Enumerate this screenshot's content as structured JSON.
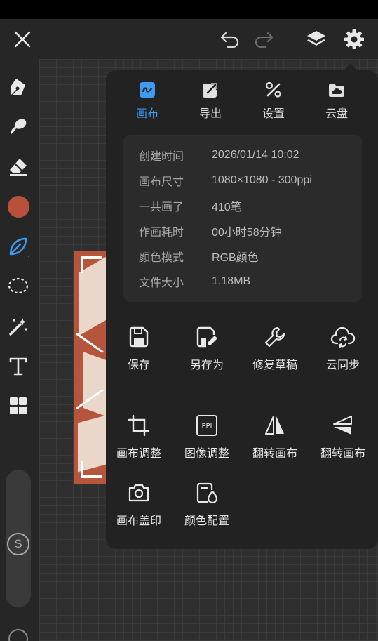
{
  "tabs": [
    {
      "label": "画布",
      "active": true
    },
    {
      "label": "导出",
      "active": false
    },
    {
      "label": "设置",
      "active": false
    },
    {
      "label": "云盘",
      "active": false
    }
  ],
  "info": [
    {
      "key": "创建时间",
      "value": "2026/01/14 10:02"
    },
    {
      "key": "画布尺寸",
      "value": "1080×1080 - 300ppi"
    },
    {
      "key": "一共画了",
      "value": "410笔"
    },
    {
      "key": "作画耗时",
      "value": "00小时58分钟"
    },
    {
      "key": "颜色模式",
      "value": "RGB颜色"
    },
    {
      "key": "文件大小",
      "value": "1.18MB"
    }
  ],
  "actions_row1": [
    "保存",
    "另存为",
    "修复草稿",
    "云同步"
  ],
  "actions_row2": [
    "画布调整",
    "图像调整",
    "翻转画布",
    "翻转画布"
  ],
  "actions_row3": [
    "画布盖印",
    "颜色配置"
  ],
  "ppi_icon_text": "PPI",
  "brush_size_label": "S",
  "colors": {
    "accent": "#3d9bf2",
    "current_color": "#b8513a",
    "panel_bg": "#222222"
  },
  "icons": {
    "topbar": [
      "close-icon",
      "undo-icon",
      "redo-icon",
      "layers-icon",
      "settings-gear-icon"
    ],
    "tools": [
      "pen-icon",
      "smudge-icon",
      "eraser-icon",
      "color-picker",
      "leaf-brush-icon",
      "lasso-select-icon",
      "magic-wand-icon",
      "text-tool-icon",
      "grid-tools-icon"
    ]
  }
}
